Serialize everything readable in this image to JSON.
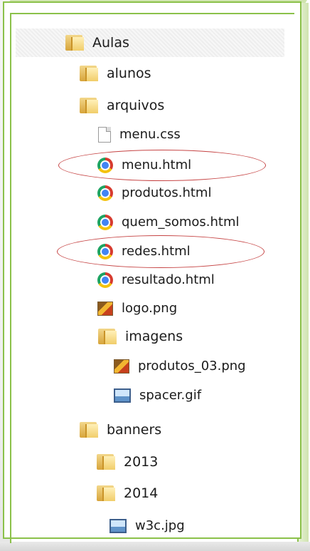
{
  "tree": {
    "root": "Aulas",
    "items": [
      {
        "label": "alunos",
        "type": "folder"
      },
      {
        "label": "arquivos",
        "type": "folder"
      },
      {
        "label": "menu.css",
        "type": "css"
      },
      {
        "label": "menu.html",
        "type": "html"
      },
      {
        "label": "produtos.html",
        "type": "html"
      },
      {
        "label": "quem_somos.html",
        "type": "html"
      },
      {
        "label": "redes.html",
        "type": "html"
      },
      {
        "label": "resultado.html",
        "type": "html"
      },
      {
        "label": "logo.png",
        "type": "png"
      },
      {
        "label": "imagens",
        "type": "folder"
      },
      {
        "label": "produtos_03.png",
        "type": "png"
      },
      {
        "label": "spacer.gif",
        "type": "gif"
      },
      {
        "label": "banners",
        "type": "folder"
      },
      {
        "label": "2013",
        "type": "folder"
      },
      {
        "label": "2014",
        "type": "folder"
      },
      {
        "label": "w3c.jpg",
        "type": "jpg"
      }
    ]
  },
  "annotations": [
    "menu.html",
    "redes.html"
  ]
}
